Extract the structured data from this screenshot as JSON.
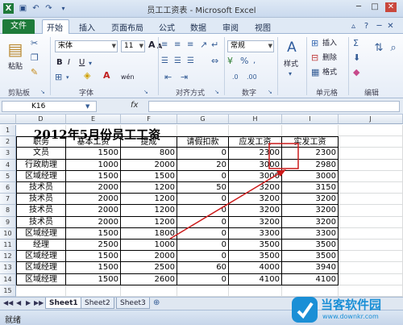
{
  "window": {
    "title": "员工工资表 - Microsoft Excel"
  },
  "ribbon": {
    "file_tab": "文件",
    "tabs": [
      "开始",
      "插入",
      "页面布局",
      "公式",
      "数据",
      "审阅",
      "视图"
    ],
    "paste_label": "粘贴",
    "font_name": "宋体",
    "font_size": "11",
    "number_format": "常规",
    "styles_label": "样式",
    "insert_label": "插入",
    "delete_label": "删除",
    "format_label": "格式",
    "group_clipboard": "剪贴板",
    "group_font": "字体",
    "group_align": "对齐方式",
    "group_number": "数字",
    "group_cells": "单元格",
    "group_edit": "编辑",
    "font_A_big": "A",
    "font_A_small": "A",
    "bold": "B",
    "italic": "I",
    "underline": "U",
    "wen": "wén"
  },
  "formula_bar": {
    "cell_ref": "K16",
    "fx": "fx",
    "content": ""
  },
  "grid": {
    "columns": [
      "D",
      "E",
      "F",
      "G",
      "H",
      "I",
      "J"
    ],
    "rows": [
      "1",
      "2",
      "3",
      "4",
      "5",
      "6",
      "7",
      "8",
      "9",
      "10",
      "11",
      "12",
      "13",
      "14",
      "15"
    ],
    "title": "2012年5月份员工工资",
    "headers": [
      "职务",
      "基本工资",
      "提成",
      "请假扣款",
      "应发工资",
      "实发工资"
    ],
    "data": [
      [
        "文员",
        "1500",
        "800",
        "0",
        "2300",
        "2300"
      ],
      [
        "行政助理",
        "1000",
        "2000",
        "20",
        "3000",
        "2980"
      ],
      [
        "区域经理",
        "1500",
        "1500",
        "0",
        "3000",
        "3000"
      ],
      [
        "技术员",
        "2000",
        "1200",
        "50",
        "3200",
        "3150"
      ],
      [
        "技术员",
        "2000",
        "1200",
        "0",
        "3200",
        "3200"
      ],
      [
        "技术员",
        "2000",
        "1200",
        "0",
        "3200",
        "3200"
      ],
      [
        "技术员",
        "2000",
        "1200",
        "0",
        "3200",
        "3200"
      ],
      [
        "区域经理",
        "1500",
        "1800",
        "0",
        "3300",
        "3300"
      ],
      [
        "经理",
        "2500",
        "1000",
        "0",
        "3500",
        "3500"
      ],
      [
        "区域经理",
        "1500",
        "2000",
        "0",
        "3500",
        "3500"
      ],
      [
        "区域经理",
        "1500",
        "2500",
        "60",
        "4000",
        "3940"
      ],
      [
        "区域经理",
        "1500",
        "2600",
        "0",
        "4100",
        "4100"
      ]
    ]
  },
  "sheets": [
    "Sheet1",
    "Sheet2",
    "Sheet3"
  ],
  "nav_arrows": [
    "◀◀",
    "◀",
    "▶",
    "▶▶"
  ],
  "status": {
    "text": "就绪"
  },
  "watermark": {
    "text": "当客软件园",
    "url_text": "www.downkr.com"
  },
  "colors": {
    "file_tab": "#1e7b3a",
    "annotation": "#cc1a1a",
    "watermark": "#1a8fd6"
  }
}
